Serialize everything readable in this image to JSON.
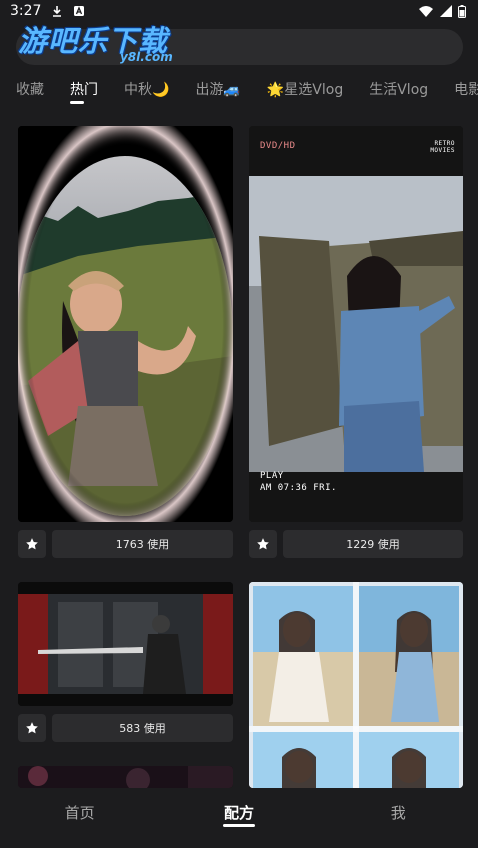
{
  "status": {
    "time": "3:27"
  },
  "logo": {
    "main": "游吧乐下载",
    "sub": "y8l.com"
  },
  "tabs": [
    "收藏",
    "热门",
    "中秋🌙",
    "出游🚙",
    "🌟星选Vlog",
    "生活Vlog",
    "电影"
  ],
  "cards": [
    {
      "uses": "1763 使用"
    },
    {
      "uses": "1229 使用",
      "overlay_top": "DVD/HD",
      "overlay_top_right": "RETRO MOVIES",
      "overlay_bottom_1": "PLAY",
      "overlay_bottom_2": "AM 07:36 FRI."
    },
    {
      "uses": "583 使用"
    },
    {
      "uses": ""
    }
  ],
  "nav": {
    "home": "首页",
    "recipe": "配方",
    "me": "我"
  },
  "colors": {
    "bg": "#1c1c1e",
    "panel": "#2c2c2e",
    "accent": "#59b7ff"
  }
}
